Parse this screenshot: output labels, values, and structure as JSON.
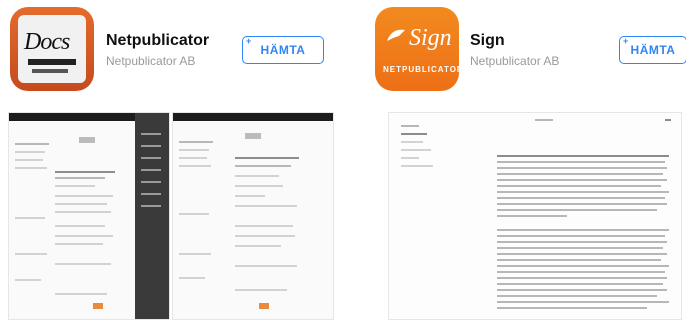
{
  "apps": [
    {
      "title": "Netpublicator",
      "developer": "Netpublicator AB",
      "button_label": "HÄMTA",
      "icon": "docs-app-icon",
      "icon_text": "Docs",
      "icon_color": "#e15e26"
    },
    {
      "title": "Sign",
      "developer": "Netpublicator AB",
      "button_label": "HÄMTA",
      "icon": "sign-app-icon",
      "icon_text": "Sign",
      "icon_brand": "NETPUBLICATOR",
      "icon_color": "#f07a19"
    }
  ],
  "colors": {
    "button_blue": "#2f86f6",
    "subtitle_gray": "#9a9a9a"
  }
}
